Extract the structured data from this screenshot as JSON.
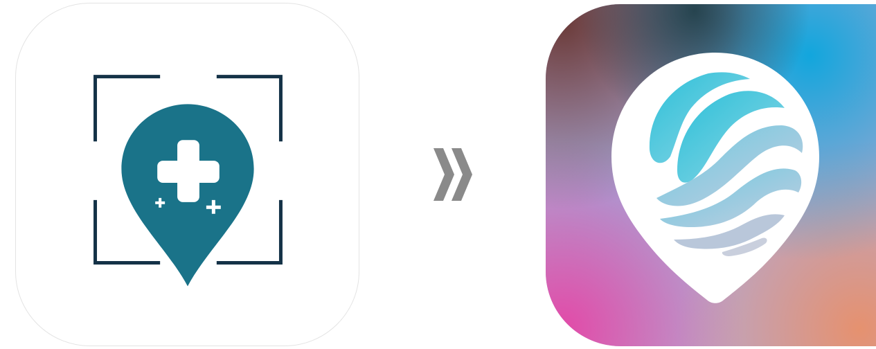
{
  "icons": {
    "old": {
      "name": "old-app-icon",
      "pin_color": "#1a7389",
      "bracket_color": "#143247",
      "background": "#ffffff"
    },
    "new": {
      "name": "new-app-icon",
      "pin_color": "#ffffff",
      "wave_colors": [
        "#2bbcd4",
        "#7fd3e6",
        "#b6c8dc"
      ],
      "gradient_colors": [
        "#5b3a3a",
        "#1aa3d8",
        "#b58bc8",
        "#e24fa7",
        "#e79b6e",
        "#2a3a48"
      ]
    }
  },
  "arrow": {
    "glyph": "chevron-double-right",
    "color": "#8a8a8a"
  }
}
